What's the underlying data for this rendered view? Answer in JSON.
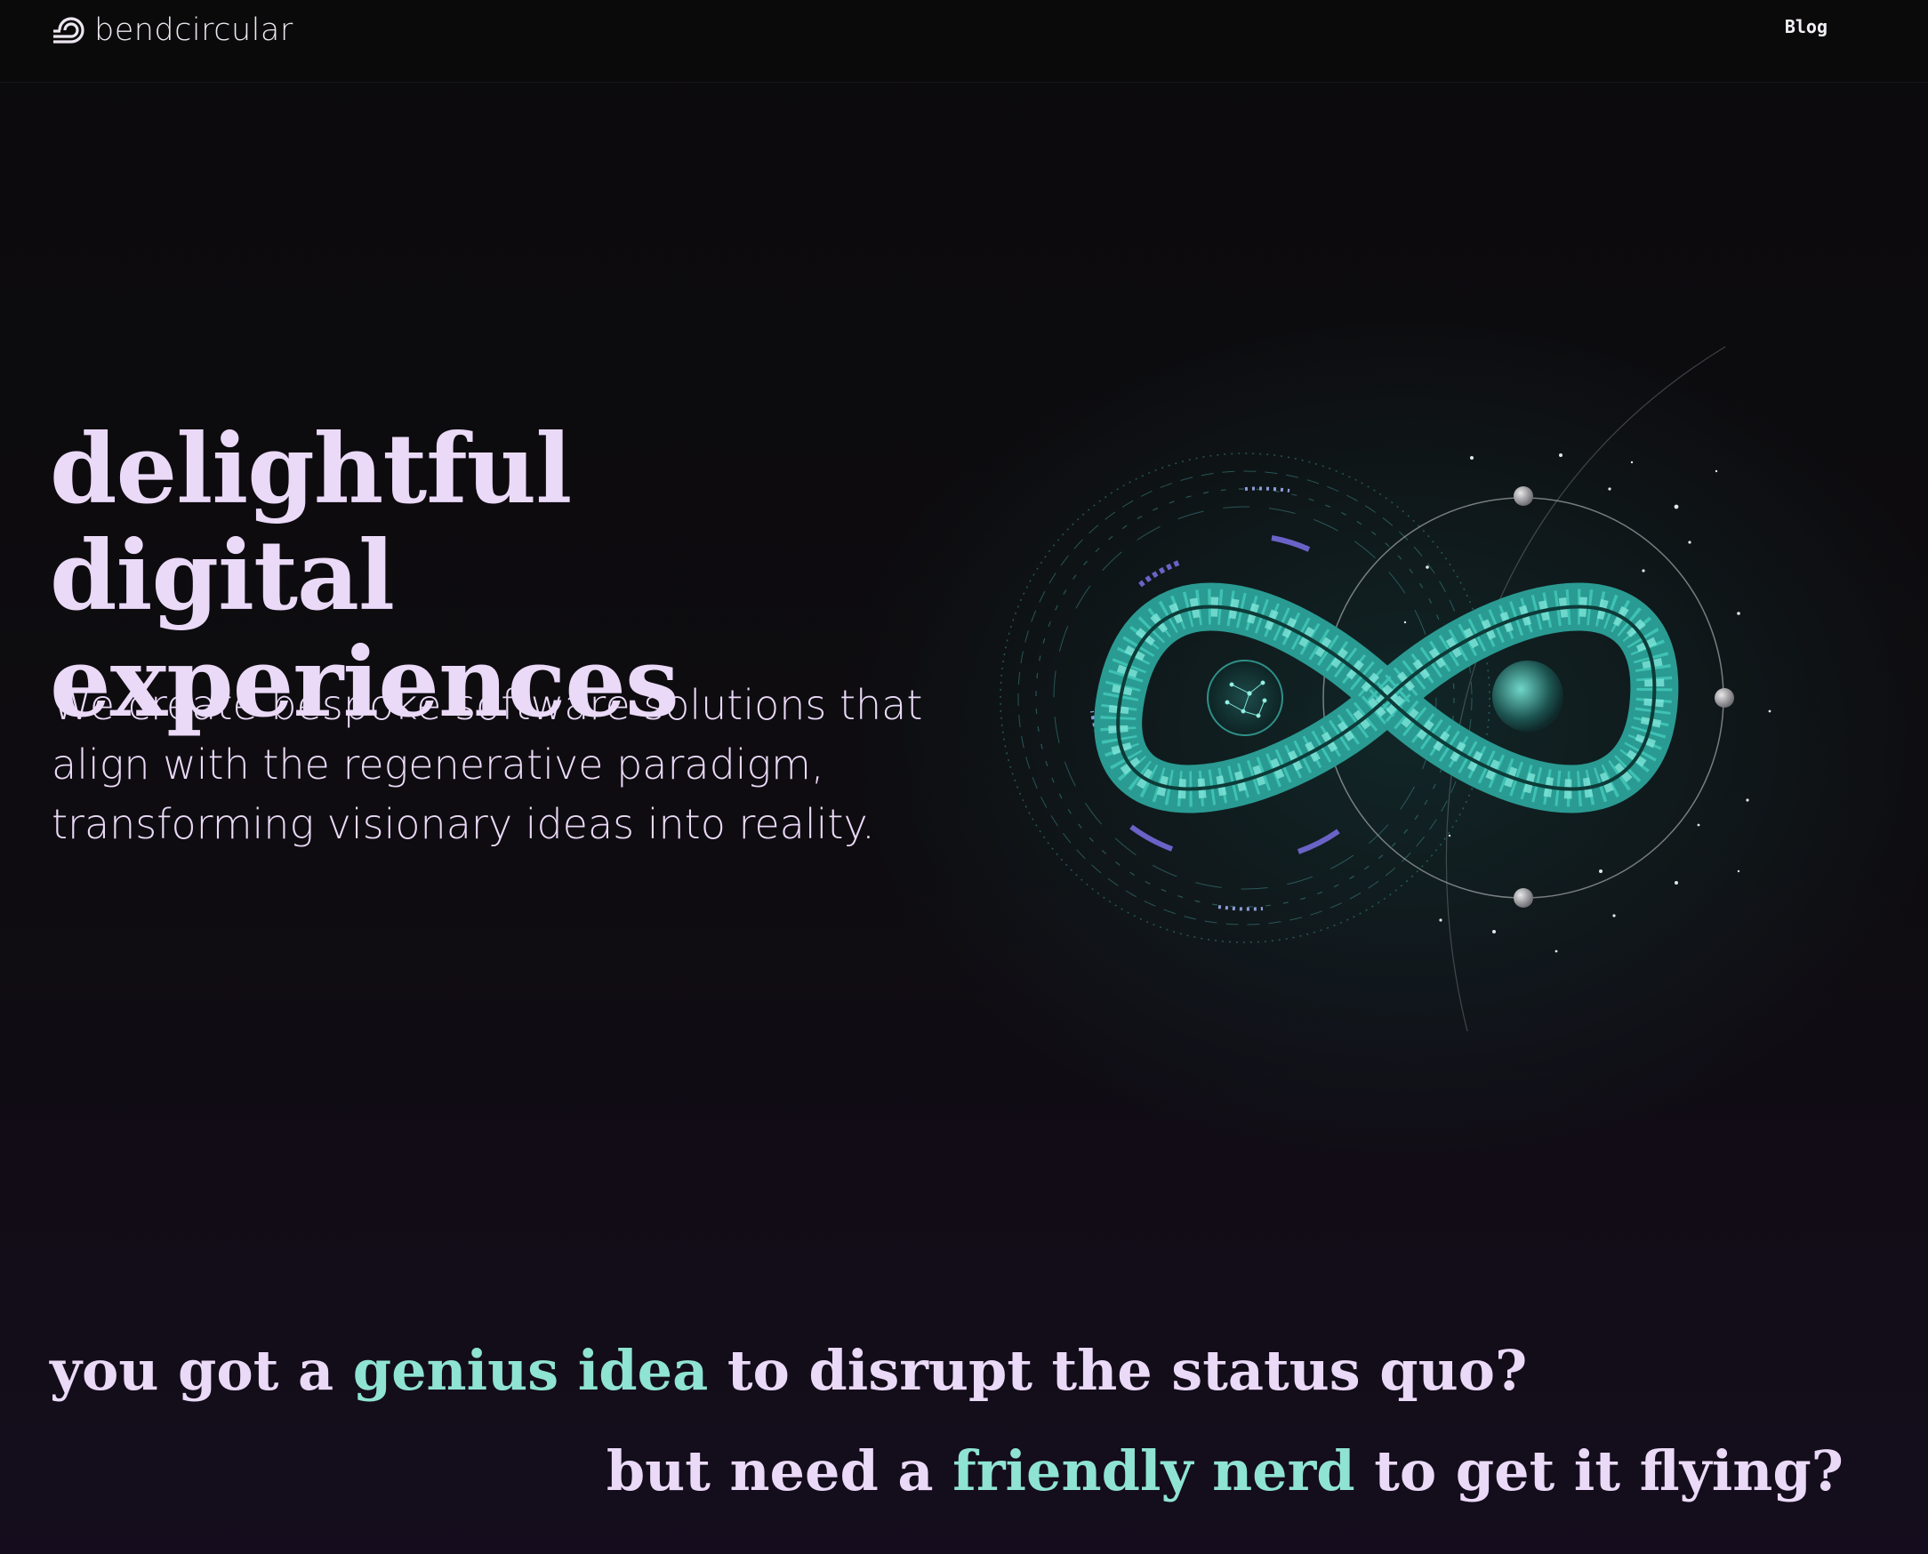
{
  "header": {
    "logo_text": "bendcircular",
    "nav": {
      "blog_label": "Blog"
    }
  },
  "hero": {
    "title_line1": "delightful digital",
    "title_line2": "experiences",
    "subtitle": "We create bespoke software solutions that align with the regenerative paradigm, transforming visionary ideas into reality."
  },
  "taglines": {
    "line1": {
      "pre": "you got a ",
      "highlight": "genius idea",
      "post": " to disrupt the status quo?"
    },
    "line2": {
      "pre": "but need a ",
      "highlight": "friendly nerd",
      "post": " to get it flying?"
    }
  },
  "colors": {
    "background": "#0b0a0c",
    "text": "#ead9f7",
    "highlight": "#8fe3d3",
    "accent": "#3bbfb0"
  },
  "illustration": {
    "name": "infinity-orbit-illustration"
  }
}
